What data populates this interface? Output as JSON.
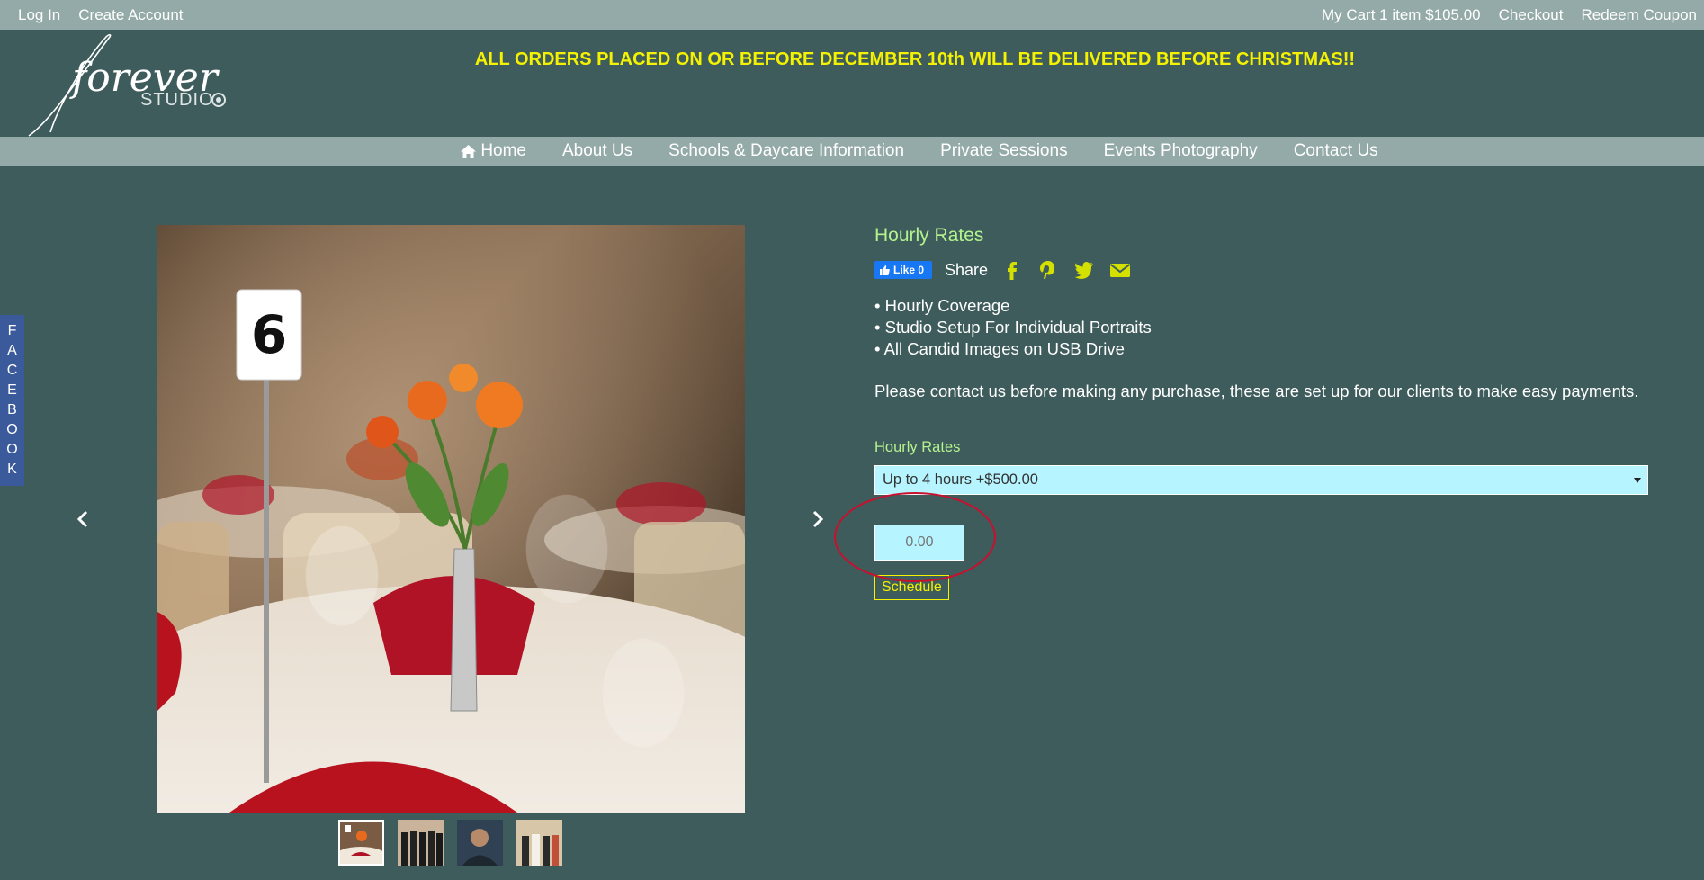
{
  "topbar": {
    "login": "Log In",
    "create_account": "Create Account",
    "cart": "My Cart 1 item $105.00",
    "checkout": "Checkout",
    "redeem": "Redeem Coupon"
  },
  "logo": {
    "word1": "forever",
    "word2": "STUDIO"
  },
  "announcement": "ALL ORDERS PLACED ON OR BEFORE DECEMBER 10th WILL BE DELIVERED BEFORE CHRISTMAS!!",
  "nav": {
    "home": "Home",
    "about": "About Us",
    "schools": "Schools & Daycare Information",
    "private": "Private Sessions",
    "events": "Events Photography",
    "contact": "Contact Us"
  },
  "facebook_tab": [
    "F",
    "A",
    "C",
    "E",
    "B",
    "O",
    "O",
    "K"
  ],
  "gallery": {
    "table_number": "6",
    "thumbnails": [
      "centerpiece",
      "group-suits",
      "portrait",
      "wedding-party"
    ]
  },
  "product": {
    "title": "Hourly Rates",
    "fb_like": "Like 0",
    "share_label": "Share",
    "bullets": [
      "• Hourly Coverage",
      "• Studio Setup For Individual Portraits",
      "• All Candid Images on USB Drive"
    ],
    "note": "Please contact us before making any purchase, these are set up for our clients to make easy payments.",
    "option_label": "Hourly Rates",
    "option_selected": "Up to 4 hours +$500.00",
    "amount_placeholder": "0.00",
    "schedule_label": "Schedule"
  },
  "colors": {
    "background": "#3f5c5c",
    "bar": "#94aaa8",
    "accent_yellow": "#f4f200",
    "accent_green": "#b4f28e",
    "input_bg": "#b6f5ff",
    "annotation_red": "#c8102e"
  }
}
